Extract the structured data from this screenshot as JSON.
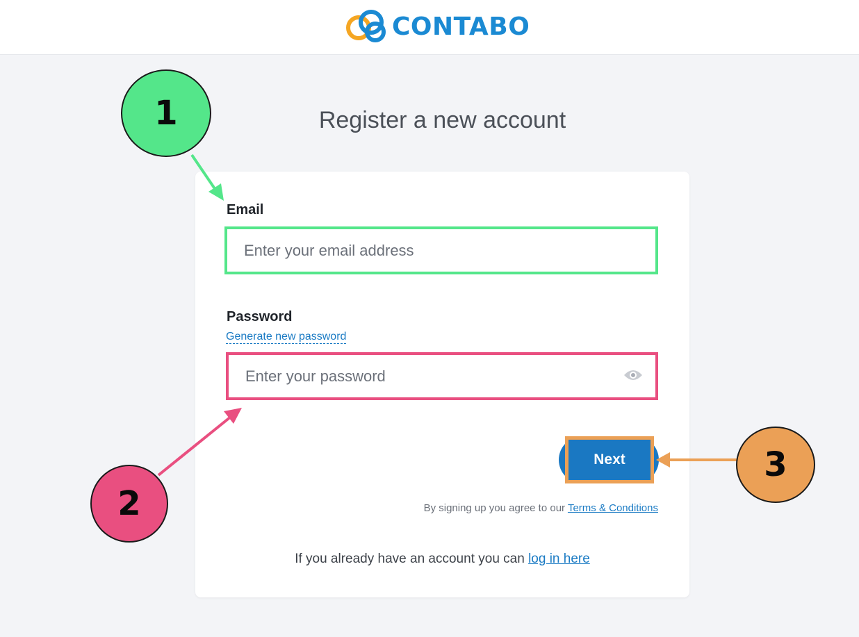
{
  "header": {
    "brand": "CONTABO"
  },
  "page": {
    "title": "Register a new account"
  },
  "form": {
    "email_label": "Email",
    "email_placeholder": "Enter your email address",
    "password_label": "Password",
    "generate_password_link": "Generate new password",
    "password_placeholder": "Enter your password",
    "next_label": "Next",
    "terms_prefix": "By signing up you agree to our ",
    "terms_link": "Terms & Conditions",
    "login_prefix": "If you already have an account you can ",
    "login_link": "log in here"
  },
  "annotations": {
    "badge_1": "1",
    "badge_2": "2",
    "badge_3": "3"
  },
  "colors": {
    "brand_blue": "#1b8ad3",
    "green_highlight": "#54e68a",
    "pink_highlight": "#e94f80",
    "orange_highlight": "#eba056"
  },
  "icons": {
    "logo": "cloud-logo-icon",
    "password_toggle": "eye-icon"
  }
}
